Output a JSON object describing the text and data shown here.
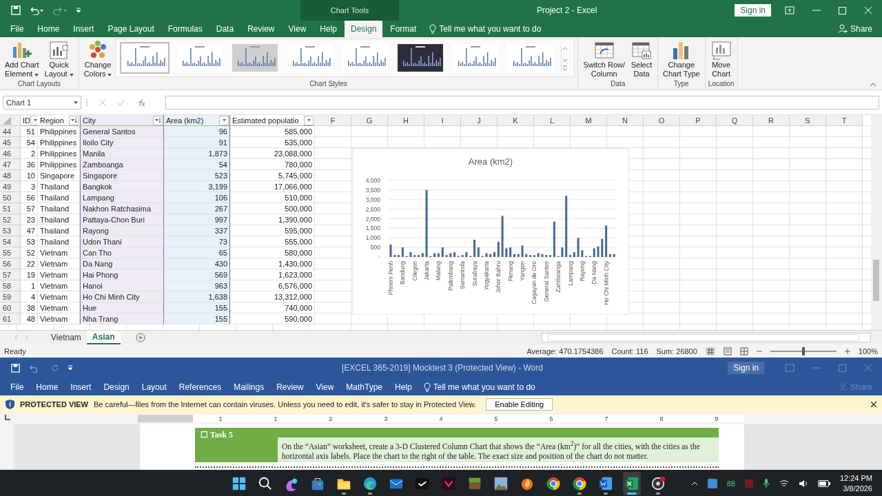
{
  "excel": {
    "quick_access": {
      "redo_disabled": true
    },
    "context_header": "Chart Tools",
    "title": "Project 2  -  Excel",
    "sign_in": "Sign in",
    "share": "Share",
    "tabs": [
      {
        "label": "File",
        "selected": false
      },
      {
        "label": "Home",
        "selected": false
      },
      {
        "label": "Insert",
        "selected": false
      },
      {
        "label": "Page Layout",
        "selected": false
      },
      {
        "label": "Formulas",
        "selected": false
      },
      {
        "label": "Data",
        "selected": false
      },
      {
        "label": "Review",
        "selected": false
      },
      {
        "label": "View",
        "selected": false
      },
      {
        "label": "Help",
        "selected": false
      },
      {
        "label": "Design",
        "selected": true
      },
      {
        "label": "Format",
        "selected": false
      }
    ],
    "tell_me": "Tell me what you want to do",
    "ribbon": {
      "groups": [
        {
          "label": "Chart Layouts",
          "buttons": [
            {
              "lines": [
                "Add Chart",
                "Element"
              ],
              "dropdown": true
            },
            {
              "lines": [
                "Quick",
                "Layout"
              ],
              "dropdown": true
            }
          ]
        },
        {
          "label": "Chart Styles",
          "buttons": [
            {
              "lines": [
                "Change",
                "Colors"
              ],
              "dropdown": true
            }
          ],
          "gallery": [
            {
              "kind": "plain",
              "selected": true
            },
            {
              "kind": "plain",
              "selected": false
            },
            {
              "kind": "gradient",
              "selected": false
            },
            {
              "kind": "plain",
              "selected": false
            },
            {
              "kind": "plain",
              "selected": false
            },
            {
              "kind": "dark",
              "selected": false
            },
            {
              "kind": "plain",
              "selected": false
            },
            {
              "kind": "plain",
              "selected": false
            }
          ]
        },
        {
          "label": "Data",
          "buttons": [
            {
              "lines": [
                "Switch Row/",
                "Column"
              ],
              "dropdown": false
            },
            {
              "lines": [
                "Select",
                "Data"
              ],
              "dropdown": false
            }
          ]
        },
        {
          "label": "Type",
          "buttons": [
            {
              "lines": [
                "Change",
                "Chart Type"
              ],
              "dropdown": false
            }
          ]
        },
        {
          "label": "Location",
          "buttons": [
            {
              "lines": [
                "Move",
                "Chart"
              ],
              "dropdown": false
            }
          ]
        }
      ]
    },
    "name_box": "Chart 1",
    "columns": [
      {
        "label": "ID",
        "sorted": false,
        "kind": "number"
      },
      {
        "label": "Region",
        "sorted": true,
        "kind": "text"
      },
      {
        "label": "City",
        "sorted": true,
        "kind": "category"
      },
      {
        "label": "Area (km2)",
        "sorted": false,
        "kind": "values"
      },
      {
        "label": "Estimated populatio",
        "sorted": false,
        "kind": "number"
      }
    ],
    "column_letters": [
      "F",
      "G",
      "H",
      "I",
      "J",
      "K",
      "L",
      "M",
      "N",
      "O",
      "P",
      "Q",
      "R",
      "S",
      "T"
    ],
    "rows": [
      {
        "row": "44",
        "cells": [
          "51",
          "Philippines",
          "General Santos",
          "96",
          "585,000"
        ]
      },
      {
        "row": "45",
        "cells": [
          "54",
          "Philippines",
          "Iloilo City",
          "91",
          "535,000"
        ]
      },
      {
        "row": "46",
        "cells": [
          "2",
          "Philippines",
          "Manila",
          "1,873",
          "23,088,000"
        ]
      },
      {
        "row": "47",
        "cells": [
          "36",
          "Philippines",
          "Zamboanga",
          "54",
          "780,000"
        ]
      },
      {
        "row": "48",
        "cells": [
          "10",
          "Singapore",
          "Singapore",
          "523",
          "5,745,000"
        ]
      },
      {
        "row": "49",
        "cells": [
          "3",
          "Thailand",
          "Bangkok",
          "3,199",
          "17,066,000"
        ]
      },
      {
        "row": "50",
        "cells": [
          "56",
          "Thailand",
          "Lampang",
          "106",
          "510,000"
        ]
      },
      {
        "row": "51",
        "cells": [
          "57",
          "Thailand",
          "Nakhon Ratchasima",
          "267",
          "500,000"
        ]
      },
      {
        "row": "52",
        "cells": [
          "23",
          "Thailand",
          "Pattaya-Chon Buri",
          "997",
          "1,390,000"
        ]
      },
      {
        "row": "53",
        "cells": [
          "47",
          "Thailand",
          "Rayong",
          "337",
          "595,000"
        ]
      },
      {
        "row": "54",
        "cells": [
          "53",
          "Thailand",
          "Udon Thani",
          "73",
          "555,000"
        ]
      },
      {
        "row": "55",
        "cells": [
          "52",
          "Vietnam",
          "Can Tho",
          "65",
          "580,000"
        ]
      },
      {
        "row": "56",
        "cells": [
          "22",
          "Vietnam",
          "Da Nang",
          "430",
          "1,430,000"
        ]
      },
      {
        "row": "57",
        "cells": [
          "19",
          "Vietnam",
          "Hai Phong",
          "569",
          "1,623,000"
        ]
      },
      {
        "row": "58",
        "cells": [
          "1",
          "Vietnam",
          "Hanoi",
          "963",
          "6,576,000"
        ]
      },
      {
        "row": "59",
        "cells": [
          "4",
          "Vietnam",
          "Ho Chi Minh City",
          "1,638",
          "13,312,000"
        ]
      },
      {
        "row": "60",
        "cells": [
          "38",
          "Vietnam",
          "Hue",
          "155",
          "740,000"
        ]
      },
      {
        "row": "61",
        "cells": [
          "48",
          "Vietnam",
          "Nha Trang",
          "155",
          "590,000"
        ]
      }
    ],
    "chart": {
      "chart_data": {
        "type": "bar",
        "title": "Area (km2)",
        "categories": [
          "Phnom Penh",
          null,
          null,
          "Bandung",
          null,
          null,
          "Cilegon",
          null,
          null,
          "Jakarta",
          null,
          null,
          "Malang",
          null,
          null,
          "Palembang",
          null,
          null,
          "Samarinda",
          null,
          null,
          "Surabaya",
          null,
          null,
          "Yogyakarta",
          null,
          null,
          "Johor Bahru",
          null,
          null,
          "Penang",
          null,
          null,
          "Yangon",
          null,
          null,
          "Cagayan de Oro",
          null,
          null,
          "General Santos",
          null,
          null,
          "Zamboanga",
          null,
          null,
          "Lampang",
          null,
          null,
          "Rayong",
          null,
          null,
          "Da Nang",
          null,
          null,
          "Ho Chi Minh City",
          null,
          null
        ],
        "values": [
          650,
          100,
          100,
          500,
          50,
          250,
          100,
          100,
          200,
          3500,
          50,
          200,
          200,
          500,
          100,
          200,
          250,
          50,
          100,
          250,
          50,
          900,
          500,
          50,
          200,
          150,
          250,
          800,
          2150,
          450,
          500,
          150,
          150,
          600,
          150,
          100,
          100,
          200,
          150,
          100,
          100,
          1850,
          50,
          500,
          3200,
          100,
          250,
          1000,
          350,
          50,
          50,
          450,
          550,
          950,
          1650,
          150,
          150
        ],
        "ylim": [
          0,
          4000
        ],
        "grid": true,
        "yticks": [
          {
            "value": 0,
            "label": "-"
          },
          {
            "value": 500,
            "label": "500"
          },
          {
            "value": 1000,
            "label": "1,000"
          },
          {
            "value": 1500,
            "label": "1,500"
          },
          {
            "value": 2000,
            "label": "2,000"
          },
          {
            "value": 2500,
            "label": "2,500"
          },
          {
            "value": 3000,
            "label": "3,000"
          },
          {
            "value": 3500,
            "label": "3,500"
          },
          {
            "value": 4000,
            "label": "4,000"
          }
        ]
      }
    },
    "sheets": [
      {
        "label": "Vietnam",
        "selected": false
      },
      {
        "label": "Asian",
        "selected": true
      }
    ],
    "status": {
      "ready": "Ready",
      "average": "Average: 470.1754386",
      "count": "Count: 116",
      "sum": "Sum: 26800",
      "zoom": "100%",
      "zoom_slider": {
        "level": 0.5
      }
    }
  },
  "word": {
    "title": "[EXCEL 365-2019] Mocktest 3 (Protected View)  -  Word",
    "sign_in": "Sign in",
    "share": "Share",
    "tabs": [
      "File",
      "Home",
      "Insert",
      "Design",
      "Layout",
      "References",
      "Mailings",
      "Review",
      "View",
      "MathType",
      "Help"
    ],
    "tell_me": "Tell me what you want to do",
    "protected": {
      "title": "PROTECTED VIEW",
      "message": "Be careful—files from the Internet can contain viruses. Unless you need to edit, it's safer to stay in Protected View.",
      "button": "Enable Editing"
    },
    "ruler": [
      "1",
      "1",
      "2",
      "3",
      "4",
      "5",
      "6",
      "7",
      "8",
      "9"
    ],
    "task": {
      "label": "☐ Task 5",
      "text": "On the “Asian” worksheet, create a 3-D Clustered Column Chart that shows the “Area (km$^{2}$)” for all the cities, with the cities as the horizontal axis labels. Place the chart to the right of the table. The exact size and position of the chart do not matter."
    }
  },
  "taskbar": {
    "apps": [
      {
        "kind": "start",
        "running": false,
        "selected": false
      },
      {
        "kind": "search",
        "running": false,
        "selected": false
      },
      {
        "kind": "swirl",
        "running": false,
        "selected": false
      },
      {
        "kind": "bag",
        "running": false,
        "selected": false
      },
      {
        "kind": "folder",
        "running": true,
        "selected": false
      },
      {
        "kind": "wave",
        "running": true,
        "selected": false
      },
      {
        "kind": "envelope",
        "running": false,
        "selected": false
      },
      {
        "kind": "check",
        "running": false,
        "selected": false
      },
      {
        "kind": "chevron",
        "running": false,
        "selected": false
      },
      {
        "kind": "block",
        "running": false,
        "selected": false
      },
      {
        "kind": "tile",
        "running": false,
        "selected": false
      },
      {
        "kind": "flame",
        "running": false,
        "selected": false
      },
      {
        "kind": "ring",
        "running": false,
        "selected": false
      },
      {
        "kind": "ring",
        "running": true,
        "selected": false
      },
      {
        "kind": "doc",
        "running": true,
        "selected": false
      },
      {
        "kind": "sheet",
        "running": true,
        "selected": true
      },
      {
        "kind": "record",
        "running": true,
        "selected": false
      }
    ],
    "tray_text": "88",
    "time": "12:24 PM",
    "date": "3/8/2026"
  }
}
